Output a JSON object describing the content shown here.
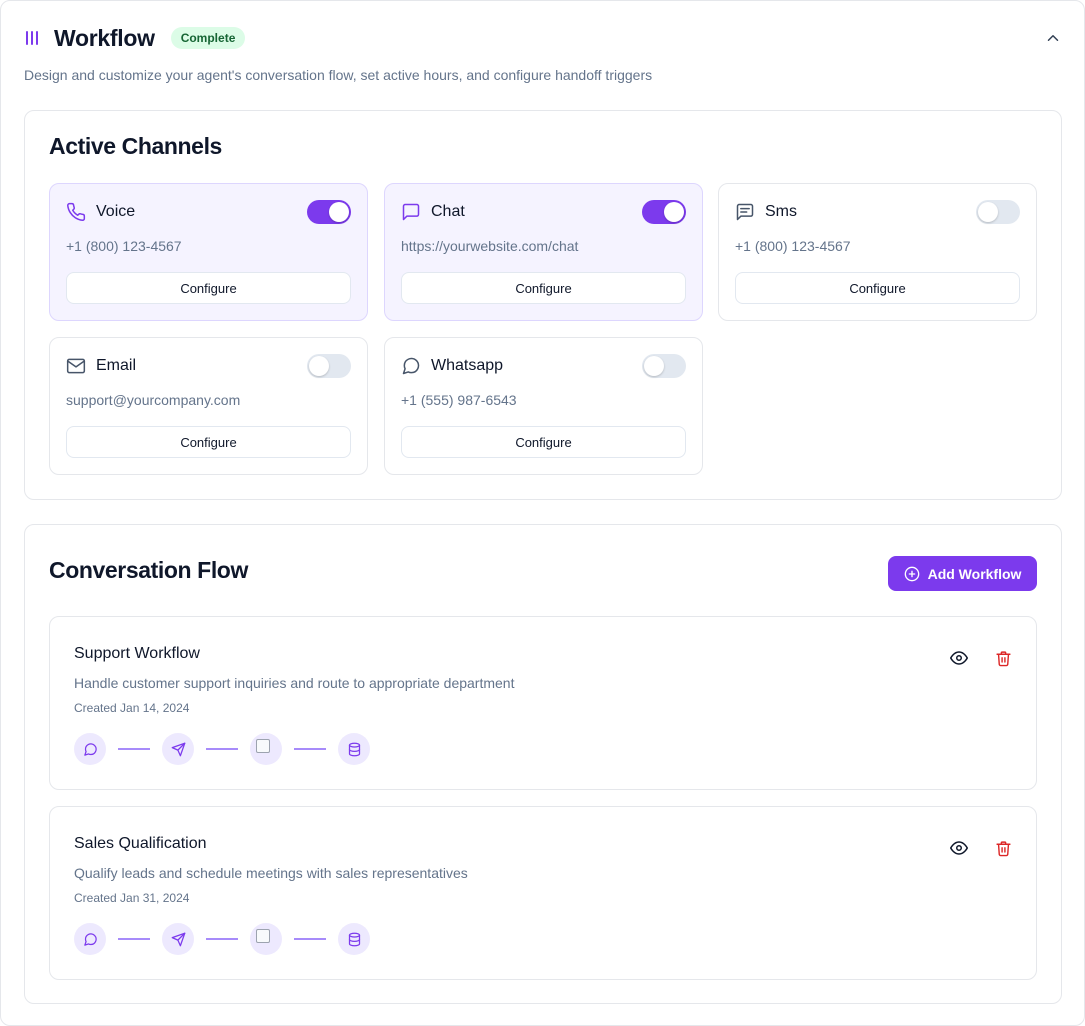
{
  "header": {
    "title": "Workflow",
    "status_badge": "Complete",
    "subtitle": "Design and customize your agent's conversation flow, set active hours, and configure handoff triggers"
  },
  "channels": {
    "title": "Active Channels",
    "configure_label": "Configure",
    "items": [
      {
        "name": "Voice",
        "detail": "+1 (800) 123-4567",
        "enabled": true,
        "icon": "phone-icon"
      },
      {
        "name": "Chat",
        "detail": "https://yourwebsite.com/chat",
        "enabled": true,
        "icon": "chat-bubble-icon"
      },
      {
        "name": "Sms",
        "detail": "+1 (800) 123-4567",
        "enabled": false,
        "icon": "message-lines-icon"
      },
      {
        "name": "Email",
        "detail": "support@yourcompany.com",
        "enabled": false,
        "icon": "mail-icon"
      },
      {
        "name": "Whatsapp",
        "detail": "+1 (555) 987-6543",
        "enabled": false,
        "icon": "speech-bubble-icon"
      }
    ]
  },
  "conversation_flow": {
    "title": "Conversation Flow",
    "add_button_label": "Add Workflow",
    "workflows": [
      {
        "name": "Support Workflow",
        "description": "Handle customer support inquiries and route to appropriate department",
        "created": "Created Jan 14, 2024"
      },
      {
        "name": "Sales Qualification",
        "description": "Qualify leads and schedule meetings with sales representatives",
        "created": "Created Jan 31, 2024"
      }
    ],
    "step_icons": [
      "chat-bubble-icon",
      "send-icon",
      "broken-image-icon",
      "database-icon"
    ]
  },
  "colors": {
    "accent": "#7c3aed",
    "accent_light": "#ede9fe",
    "badge_bg": "#dcfce7",
    "badge_text": "#166534",
    "delete": "#dc2626"
  }
}
